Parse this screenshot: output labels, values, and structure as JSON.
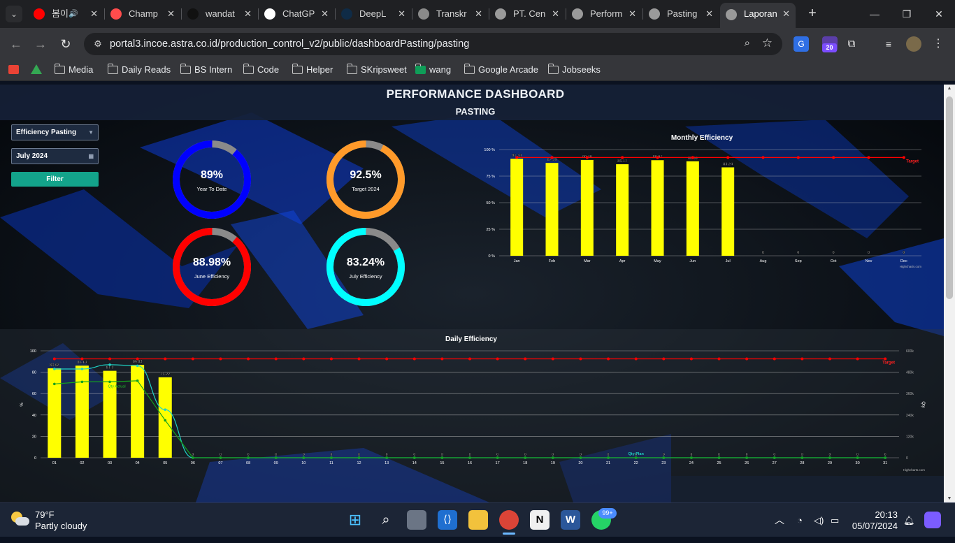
{
  "browser": {
    "tabs": [
      {
        "title": "봄이",
        "color": "#ff0000",
        "extra": "🔊"
      },
      {
        "title": "Champ",
        "color": "#ff4c4c"
      },
      {
        "title": "wandat",
        "color": "#111111"
      },
      {
        "title": "ChatGP",
        "color": "#ffffff"
      },
      {
        "title": "DeepL",
        "color": "#0f2b46"
      },
      {
        "title": "Transkr",
        "color": "#8a8a8a"
      },
      {
        "title": "PT. Cen",
        "color": "#9a9a9a"
      },
      {
        "title": "Perform",
        "color": "#9a9a9a"
      },
      {
        "title": "Pasting",
        "color": "#9a9a9a"
      },
      {
        "title": "Laporan",
        "color": "#9a9a9a",
        "active": true
      }
    ],
    "url": "portal3.incoe.astra.co.id/production_control_v2/public/dashboardPasting/pasting",
    "extension_badge": "20",
    "bookmarks": [
      "Media",
      "Daily Reads",
      "BS Intern",
      "Code",
      "Helper",
      "SKripsweet",
      "wang",
      "Google Arcade",
      "Jobseeks"
    ]
  },
  "dashboard": {
    "title": "PERFORMANCE DASHBOARD",
    "subtitle": "PASTING",
    "filter": {
      "type_value": "Efficiency Pasting",
      "month_value": "July 2024",
      "button_label": "Filter"
    },
    "gauges": [
      {
        "value": "89%",
        "label": "Year To Date",
        "color": "#0000ff",
        "fraction": 0.89
      },
      {
        "value": "92.5%",
        "label": "Target 2024",
        "color": "#ff9a2a",
        "fraction": 0.925
      },
      {
        "value": "88.98%",
        "label": "June Efficiency",
        "color": "#ff0000",
        "fraction": 0.8898
      },
      {
        "value": "83.24%",
        "label": "July Efficiency",
        "color": "#00ffff",
        "fraction": 0.8324
      }
    ],
    "credits": "Highcharts.com"
  },
  "chart_data": [
    {
      "type": "bar",
      "title": "Monthly Efficiency",
      "categories": [
        "Jan",
        "Feb",
        "Mar",
        "Apr",
        "May",
        "Jun",
        "Jul",
        "Aug",
        "Sep",
        "Oct",
        "Nov",
        "Dec"
      ],
      "series": [
        {
          "values": [
            91.34,
            87.39,
            90.19,
            86.17,
            89.97,
            88.98,
            83.24,
            0,
            0,
            0,
            0,
            0
          ],
          "color": "#ffff00"
        },
        {
          "name": "Target",
          "type": "line",
          "values": [
            92.5,
            92.5,
            92.5,
            92.5,
            92.5,
            92.5,
            92.5,
            92.5,
            92.5,
            92.5,
            92.5,
            92.5
          ],
          "color": "#ff0000"
        }
      ],
      "data_labels": [
        "91.34",
        "87.39",
        "90.19",
        "86.17",
        "89.97",
        "88.98",
        "83.24",
        "0",
        "0",
        "0",
        "0",
        "0"
      ],
      "y_ticks": [
        "0 %",
        "25 %",
        "50 %",
        "75 %",
        "100 %"
      ],
      "ylim": [
        0,
        100
      ],
      "grid": true
    },
    {
      "type": "bar",
      "title": "Daily Efficiency",
      "categories": [
        "01",
        "02",
        "03",
        "04",
        "05",
        "06",
        "07",
        "08",
        "09",
        "10",
        "11",
        "12",
        "13",
        "14",
        "15",
        "16",
        "17",
        "18",
        "19",
        "20",
        "21",
        "22",
        "23",
        "24",
        "25",
        "26",
        "27",
        "28",
        "29",
        "30",
        "31"
      ],
      "series": [
        {
          "values": [
            83.62,
            86.14,
            81.3,
            86.83,
            75.22,
            0,
            0,
            0,
            0,
            0,
            0,
            0,
            0,
            0,
            0,
            0,
            0,
            0,
            0,
            0,
            0,
            0,
            0,
            0,
            0,
            0,
            0,
            0,
            0,
            0,
            0
          ],
          "color": "#ffff00"
        },
        {
          "name": "Target",
          "type": "line",
          "values": [
            92.5,
            92.5,
            92.5,
            92.5,
            92.5,
            92.5,
            92.5,
            92.5,
            92.5,
            92.5,
            92.5,
            92.5,
            92.5,
            92.5,
            92.5,
            92.5,
            92.5,
            92.5,
            92.5,
            92.5,
            92.5,
            92.5,
            92.5,
            92.5,
            92.5,
            92.5,
            92.5,
            92.5,
            92.5,
            92.5,
            92.5
          ],
          "color": "#ff0000"
        },
        {
          "name": "Qty Actual",
          "type": "line",
          "values": [
            69,
            71,
            71,
            72,
            35,
            0,
            0,
            0,
            0,
            0,
            0,
            0,
            0,
            0,
            0,
            0,
            0,
            0,
            0,
            0,
            0,
            0,
            0,
            0,
            0,
            0,
            0,
            0,
            0,
            0,
            0
          ],
          "color": "#14a31e"
        },
        {
          "name": "Qty Plan",
          "type": "spline",
          "values": [
            83,
            83,
            87,
            86,
            45,
            0,
            0,
            0,
            0,
            0,
            0,
            0,
            0,
            0,
            0,
            0,
            0,
            0,
            0,
            0,
            0,
            0,
            0,
            0,
            0,
            0,
            0,
            0,
            0,
            0,
            0
          ],
          "color": "#1fd3c5"
        }
      ],
      "data_labels": [
        "83.62",
        "86.14",
        "81.3",
        "86.83",
        "75.22",
        "0",
        "0",
        "0",
        "0",
        "0",
        "0",
        "0",
        "0",
        "0",
        "0",
        "0",
        "0",
        "0",
        "0",
        "0",
        "0",
        "0",
        "0",
        "0",
        "0",
        "0",
        "0",
        "0",
        "0",
        "0",
        "0"
      ],
      "y_ticks": [
        "0",
        "20",
        "40",
        "60",
        "80",
        "100"
      ],
      "y2_ticks": [
        "0",
        "120k",
        "240k",
        "360k",
        "480k",
        "600k"
      ],
      "ylabel": "%",
      "y2label": "Qty",
      "ylim": [
        0,
        100
      ],
      "grid": true
    }
  ],
  "taskbar": {
    "weather_temp": "79°F",
    "weather_desc": "Partly cloudy",
    "notif_badge": "99+",
    "time": "20:13",
    "date": "05/07/2024"
  }
}
